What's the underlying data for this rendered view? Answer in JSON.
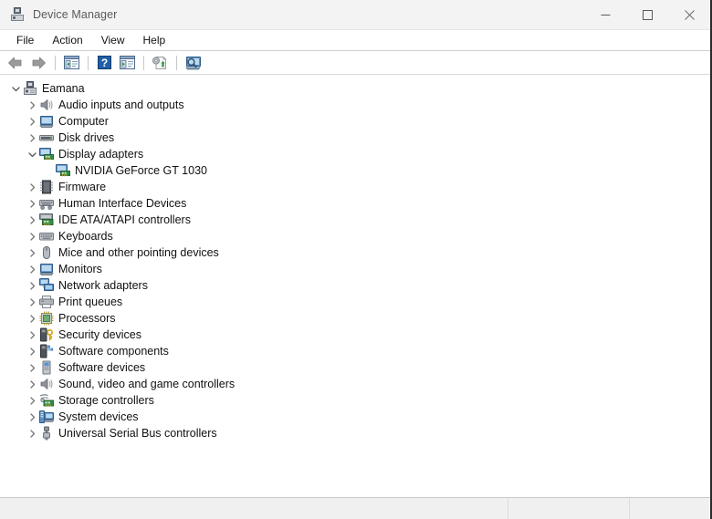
{
  "window": {
    "title": "Device Manager",
    "title_icon": "device-manager-icon",
    "controls": [
      {
        "name": "minimize-button",
        "glyph": "minimize"
      },
      {
        "name": "maximize-button",
        "glyph": "maximize"
      },
      {
        "name": "close-button",
        "glyph": "close"
      }
    ]
  },
  "menubar": {
    "items": [
      {
        "label": "File"
      },
      {
        "label": "Action"
      },
      {
        "label": "View"
      },
      {
        "label": "Help"
      }
    ]
  },
  "toolbar": {
    "buttons": [
      {
        "name": "back-button",
        "icon": "back-arrow-icon"
      },
      {
        "name": "forward-button",
        "icon": "forward-arrow-icon"
      },
      {
        "name": "show-hide-console-tree-button",
        "icon": "console-tree-icon"
      },
      {
        "name": "help-button",
        "icon": "help-question-icon"
      },
      {
        "name": "properties-button",
        "icon": "properties-icon"
      },
      {
        "name": "update-driver-button",
        "icon": "update-driver-icon"
      },
      {
        "name": "scan-for-hardware-changes-button",
        "icon": "scan-hardware-icon"
      }
    ]
  },
  "tree": {
    "root": {
      "label": "Eamana",
      "icon": "computer-root-icon",
      "expanded": true,
      "twisty": "chevron-down"
    },
    "items": [
      {
        "label": "Audio inputs and outputs",
        "icon": "speaker-icon",
        "twisty": "chevron-right",
        "level": 1
      },
      {
        "label": "Computer",
        "icon": "monitor-icon",
        "twisty": "chevron-right",
        "level": 1
      },
      {
        "label": "Disk drives",
        "icon": "disk-drive-icon",
        "twisty": "chevron-right",
        "level": 1
      },
      {
        "label": "Display adapters",
        "icon": "display-adapter-icon",
        "twisty": "chevron-down",
        "level": 1
      },
      {
        "label": "NVIDIA GeForce GT 1030",
        "icon": "display-adapter-icon",
        "twisty": "none",
        "level": 2
      },
      {
        "label": "Firmware",
        "icon": "firmware-chip-icon",
        "twisty": "chevron-right",
        "level": 1
      },
      {
        "label": "Human Interface Devices",
        "icon": "hid-icon",
        "twisty": "chevron-right",
        "level": 1
      },
      {
        "label": "IDE ATA/ATAPI controllers",
        "icon": "ide-controller-icon",
        "twisty": "chevron-right",
        "level": 1
      },
      {
        "label": "Keyboards",
        "icon": "keyboard-icon",
        "twisty": "chevron-right",
        "level": 1
      },
      {
        "label": "Mice and other pointing devices",
        "icon": "mouse-icon",
        "twisty": "chevron-right",
        "level": 1
      },
      {
        "label": "Monitors",
        "icon": "monitor-icon",
        "twisty": "chevron-right",
        "level": 1
      },
      {
        "label": "Network adapters",
        "icon": "network-adapter-icon",
        "twisty": "chevron-right",
        "level": 1
      },
      {
        "label": "Print queues",
        "icon": "printer-icon",
        "twisty": "chevron-right",
        "level": 1
      },
      {
        "label": "Processors",
        "icon": "processor-icon",
        "twisty": "chevron-right",
        "level": 1
      },
      {
        "label": "Security devices",
        "icon": "security-device-icon",
        "twisty": "chevron-right",
        "level": 1
      },
      {
        "label": "Software components",
        "icon": "software-component-icon",
        "twisty": "chevron-right",
        "level": 1
      },
      {
        "label": "Software devices",
        "icon": "software-device-icon",
        "twisty": "chevron-right",
        "level": 1
      },
      {
        "label": "Sound, video and game controllers",
        "icon": "speaker-icon",
        "twisty": "chevron-right",
        "level": 1
      },
      {
        "label": "Storage controllers",
        "icon": "storage-controller-icon",
        "twisty": "chevron-right",
        "level": 1
      },
      {
        "label": "System devices",
        "icon": "system-device-icon",
        "twisty": "chevron-right",
        "level": 1
      },
      {
        "label": "Universal Serial Bus controllers",
        "icon": "usb-icon",
        "twisty": "chevron-right",
        "level": 1
      }
    ]
  },
  "statusbar": {
    "panes": [
      {
        "name": "status-pane-main",
        "text": ""
      },
      {
        "name": "status-pane-secondary",
        "text": ""
      },
      {
        "name": "status-pane-tertiary",
        "text": ""
      }
    ]
  },
  "colors": {
    "titlebar_bg": "#f3f3f3",
    "titlebar_text": "#5a5a5a",
    "body_bg": "#ffffff",
    "text": "#101010",
    "statusbar_bg": "#f0f0f0",
    "toolbar_border": "#cfcfd4",
    "chevron": "#767676"
  }
}
